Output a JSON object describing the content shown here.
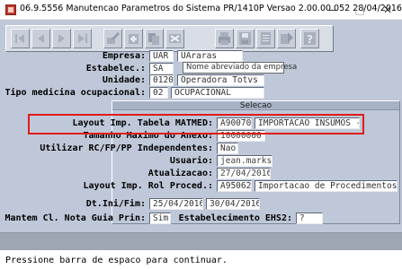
{
  "window": {
    "title": "06.9.5556 Manutencao  Parametros do Sistema PR/1410P Versao 2.00.00.052 28/04/2016 - ...",
    "min_glyph": "—",
    "max_glyph": "□",
    "close_glyph": "✕"
  },
  "toolbar": {
    "icons": [
      "first-icon",
      "previous-icon",
      "next-icon",
      "last-icon",
      "edit-icon",
      "add-icon",
      "copy-icon",
      "delete-icon",
      "print-icon",
      "save-icon",
      "list-icon",
      "help-icon"
    ]
  },
  "form": {
    "empresa": {
      "label": "Empresa:",
      "code": "UAR",
      "name": "UAraras"
    },
    "estabelec": {
      "label": "Estabelec.:",
      "code": "SA"
    },
    "tooltip": "Nome abreviado da empresa",
    "unidade": {
      "label": "Unidade:",
      "code": "0120",
      "name": "Operadora Totvs"
    },
    "tipo_medicina": {
      "label": "Tipo medicina ocupacional:",
      "code": "02",
      "name": "OCUPACIONAL"
    }
  },
  "selecao": {
    "title": "Selecao",
    "layout_matmed": {
      "label": "Layout Imp. Tabela MATMED:",
      "code": "A90070",
      "name": "IMPORTACAO INSUMOS - PT"
    },
    "tamanho_anexo": {
      "label": "Tamanho Maximo do Anexo:",
      "value": "10000000"
    },
    "utilizar_rc": {
      "label": "Utilizar RC/FP/PP Independentes:",
      "value": "Nao"
    },
    "usuario": {
      "label": "Usuario:",
      "value": "jean.marks"
    },
    "atualizacao": {
      "label": "Atualizacao:",
      "value": "27/04/2016"
    },
    "layout_rol": {
      "label": "Layout Imp. Rol Proced.:",
      "code": "A95062",
      "name": "Importacao de Procedimentos PTU"
    }
  },
  "dates": {
    "label": "Dt.Ini/Fim:",
    "start": "25/04/2016",
    "end": "30/04/2016"
  },
  "mantem": {
    "label": "Mantem Cl. Nota Guia Prin:",
    "value": "Sim"
  },
  "ehs2": {
    "label": "Estabelecimento EHS2:",
    "value": "?"
  },
  "status": {
    "prompt": "Pressione barra de espaco para continuar."
  }
}
